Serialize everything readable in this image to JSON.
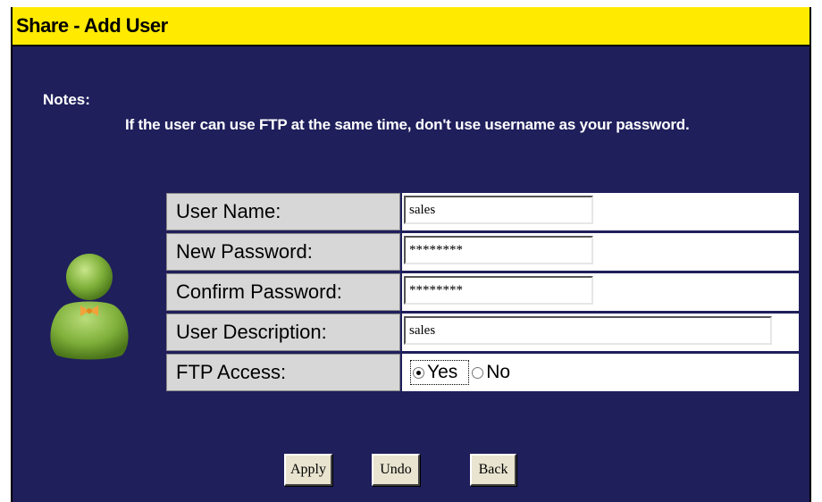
{
  "window": {
    "title": "Share - Add User"
  },
  "notes": {
    "label": "Notes:",
    "text": "If the user can use FTP at the same time, don't use username as your password."
  },
  "form": {
    "user_name": {
      "label": "User Name:",
      "value": "sales"
    },
    "new_password": {
      "label": "New Password:",
      "value": "********"
    },
    "confirm_password": {
      "label": "Confirm Password:",
      "value": "********"
    },
    "user_description": {
      "label": "User Description:",
      "value": "sales"
    },
    "ftp_access": {
      "label": "FTP Access:",
      "options": [
        "Yes",
        "No"
      ],
      "selected": "Yes"
    }
  },
  "buttons": {
    "apply": "Apply",
    "undo": "Undo",
    "back": "Back"
  },
  "colors": {
    "title_bar": "#ffea00",
    "background": "#1f1f5c",
    "label_cell": "#d7d7d7",
    "avatar_green": "#7fb03a",
    "avatar_bowtie": "#f2a23a"
  },
  "icons": {
    "avatar": "user-avatar-icon"
  }
}
